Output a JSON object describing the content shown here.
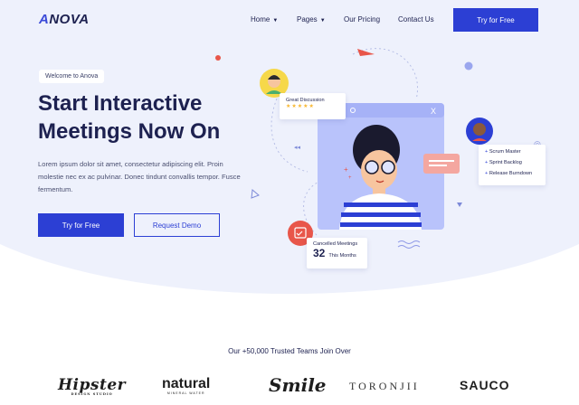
{
  "brand": {
    "logo_mark": "A",
    "logo_rest": "NOVA"
  },
  "nav": {
    "home": "Home",
    "pages": "Pages",
    "pricing": "Our Pricing",
    "contact": "Contact Us",
    "cta": "Try for Free"
  },
  "hero": {
    "badge": "Welcome to Anova",
    "title_line1": "Start Interactive",
    "title_line2": "Meetings Now On",
    "description": "Lorem ipsum dolor sit amet, consectetur adipiscing elit. Proin molestie nec ex ac pulvinar. Donec tindunt convallis tempor. Fusce fermentum.",
    "primary_button": "Try for Free",
    "secondary_button": "Request Demo"
  },
  "illustration": {
    "discussion_card": {
      "title": "Great Discussion",
      "stars": "★★★★★"
    },
    "window_close": "X",
    "agenda": [
      "Scrum Master",
      "Sprint Backlog",
      "Release Burndown"
    ],
    "cancelled": {
      "label": "Cancelled Meetings",
      "count": "32",
      "period": "This Months"
    }
  },
  "trusted": {
    "heading": "Our +50,000 Trusted Teams Join Over",
    "brands": [
      "Hipster",
      "natural",
      "Smile",
      "TORONJII",
      "SAUCO"
    ],
    "hipster_tag": "DESIGN STUDIO",
    "natural_tag": "MINERAL WATER"
  },
  "colors": {
    "primary": "#2c3fd4",
    "hero_bg": "#eef1fc",
    "accent_red": "#e8564a",
    "star": "#f7b731"
  }
}
